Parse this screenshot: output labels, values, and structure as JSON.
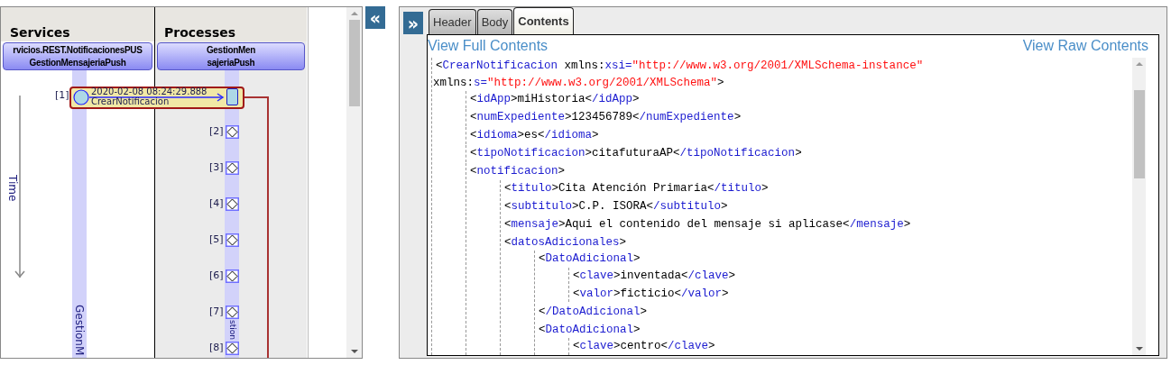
{
  "sequence_diagram": {
    "collapse_button": "«",
    "time_axis": "Time",
    "columns": [
      {
        "title": "Services",
        "participant": [
          "rvicios.REST.NotificacionesPUS",
          "GestionMensajeriaPush"
        ],
        "lifeline_label": "GestionM"
      },
      {
        "title": "Processes",
        "participant": [
          "GestionMen",
          "sajeriaPush"
        ],
        "lifeline_label": "stion"
      }
    ],
    "message": {
      "index": "[1]",
      "timestamp": "2020-02-08 08:24:29.888",
      "name": "CrearNotificacion",
      "selected": true
    },
    "events": [
      {
        "index": "[2]"
      },
      {
        "index": "[3]"
      },
      {
        "index": "[4]"
      },
      {
        "index": "[5]"
      },
      {
        "index": "[6]"
      },
      {
        "index": "[7]"
      },
      {
        "index": "[8]"
      }
    ]
  },
  "detail_panel": {
    "expand_button": "»",
    "tabs": [
      {
        "label": "Header",
        "selected": false
      },
      {
        "label": "Body",
        "selected": false
      },
      {
        "label": "Contents",
        "selected": true
      }
    ],
    "links": [
      "View Full Contents",
      "View Raw Contents"
    ],
    "xml": [
      {
        "lines": [
          [
            {
              "kind": "punct",
              "text": "<"
            },
            {
              "kind": "tag",
              "text": "CrearNotificacion"
            },
            {
              "kind": "attr",
              "text": " xmlns:"
            },
            {
              "kind": "tag",
              "text": "xsi="
            },
            {
              "kind": "value",
              "text": "\"http://www.w3.org/2001/XMLSchema-instance\""
            }
          ],
          [
            {
              "kind": "attr",
              "text": "xmlns:"
            },
            {
              "kind": "tag",
              "text": "s="
            },
            {
              "kind": "value",
              "text": "\"http://www.w3.org/2001/XMLSchema\""
            },
            {
              "kind": "punct",
              "text": ">"
            }
          ]
        ],
        "children": [
          {
            "lines": [
              [
                {
                  "kind": "punct",
                  "text": "<"
                },
                {
                  "kind": "tag",
                  "text": "idApp"
                },
                {
                  "kind": "punct",
                  "text": ">"
                },
                {
                  "kind": "text",
                  "text": "miHistoria"
                },
                {
                  "kind": "punct",
                  "text": "<"
                },
                {
                  "kind": "tag",
                  "text": "/idApp"
                },
                {
                  "kind": "punct",
                  "text": ">"
                }
              ]
            ]
          },
          {
            "lines": [
              [
                {
                  "kind": "punct",
                  "text": "<"
                },
                {
                  "kind": "tag",
                  "text": "numExpediente"
                },
                {
                  "kind": "punct",
                  "text": ">"
                },
                {
                  "kind": "text",
                  "text": "123456789"
                },
                {
                  "kind": "punct",
                  "text": "<"
                },
                {
                  "kind": "tag",
                  "text": "/numExpediente"
                },
                {
                  "kind": "punct",
                  "text": ">"
                }
              ]
            ]
          },
          {
            "lines": [
              [
                {
                  "kind": "punct",
                  "text": "<"
                },
                {
                  "kind": "tag",
                  "text": "idioma"
                },
                {
                  "kind": "punct",
                  "text": ">"
                },
                {
                  "kind": "text",
                  "text": "es"
                },
                {
                  "kind": "punct",
                  "text": "<"
                },
                {
                  "kind": "tag",
                  "text": "/idioma"
                },
                {
                  "kind": "punct",
                  "text": ">"
                }
              ]
            ]
          },
          {
            "lines": [
              [
                {
                  "kind": "punct",
                  "text": "<"
                },
                {
                  "kind": "tag",
                  "text": "tipoNotificacion"
                },
                {
                  "kind": "punct",
                  "text": ">"
                },
                {
                  "kind": "text",
                  "text": "citafuturaAP"
                },
                {
                  "kind": "punct",
                  "text": "<"
                },
                {
                  "kind": "tag",
                  "text": "/tipoNotificacion"
                },
                {
                  "kind": "punct",
                  "text": ">"
                }
              ]
            ]
          },
          {
            "lines": [
              [
                {
                  "kind": "punct",
                  "text": "<"
                },
                {
                  "kind": "tag",
                  "text": "notificacion"
                },
                {
                  "kind": "punct",
                  "text": ">"
                }
              ]
            ],
            "children": [
              {
                "lines": [
                  [
                    {
                      "kind": "punct",
                      "text": "<"
                    },
                    {
                      "kind": "tag",
                      "text": "titulo"
                    },
                    {
                      "kind": "punct",
                      "text": ">"
                    },
                    {
                      "kind": "text",
                      "text": "Cita Atención Primaria"
                    },
                    {
                      "kind": "punct",
                      "text": "<"
                    },
                    {
                      "kind": "tag",
                      "text": "/titulo"
                    },
                    {
                      "kind": "punct",
                      "text": ">"
                    }
                  ]
                ]
              },
              {
                "lines": [
                  [
                    {
                      "kind": "punct",
                      "text": "<"
                    },
                    {
                      "kind": "tag",
                      "text": "subtitulo"
                    },
                    {
                      "kind": "punct",
                      "text": ">"
                    },
                    {
                      "kind": "text",
                      "text": "C.P. ISORA"
                    },
                    {
                      "kind": "punct",
                      "text": "<"
                    },
                    {
                      "kind": "tag",
                      "text": "/subtitulo"
                    },
                    {
                      "kind": "punct",
                      "text": ">"
                    }
                  ]
                ]
              },
              {
                "lines": [
                  [
                    {
                      "kind": "punct",
                      "text": "<"
                    },
                    {
                      "kind": "tag",
                      "text": "mensaje"
                    },
                    {
                      "kind": "punct",
                      "text": ">"
                    },
                    {
                      "kind": "text",
                      "text": "Aqui el contenido del mensaje si aplicase"
                    },
                    {
                      "kind": "punct",
                      "text": "<"
                    },
                    {
                      "kind": "tag",
                      "text": "/mensaje"
                    },
                    {
                      "kind": "punct",
                      "text": ">"
                    }
                  ]
                ]
              },
              {
                "lines": [
                  [
                    {
                      "kind": "punct",
                      "text": "<"
                    },
                    {
                      "kind": "tag",
                      "text": "datosAdicionales"
                    },
                    {
                      "kind": "punct",
                      "text": ">"
                    }
                  ]
                ],
                "children": [
                  {
                    "lines": [
                      [
                        {
                          "kind": "punct",
                          "text": "<"
                        },
                        {
                          "kind": "tag",
                          "text": "DatoAdicional"
                        },
                        {
                          "kind": "punct",
                          "text": ">"
                        }
                      ]
                    ],
                    "children": [
                      {
                        "lines": [
                          [
                            {
                              "kind": "punct",
                              "text": "<"
                            },
                            {
                              "kind": "tag",
                              "text": "clave"
                            },
                            {
                              "kind": "punct",
                              "text": ">"
                            },
                            {
                              "kind": "text",
                              "text": "inventada"
                            },
                            {
                              "kind": "punct",
                              "text": "<"
                            },
                            {
                              "kind": "tag",
                              "text": "/clave"
                            },
                            {
                              "kind": "punct",
                              "text": ">"
                            }
                          ]
                        ]
                      },
                      {
                        "lines": [
                          [
                            {
                              "kind": "punct",
                              "text": "<"
                            },
                            {
                              "kind": "tag",
                              "text": "valor"
                            },
                            {
                              "kind": "punct",
                              "text": ">"
                            },
                            {
                              "kind": "text",
                              "text": "ficticio"
                            },
                            {
                              "kind": "punct",
                              "text": "<"
                            },
                            {
                              "kind": "tag",
                              "text": "/valor"
                            },
                            {
                              "kind": "punct",
                              "text": ">"
                            }
                          ]
                        ]
                      }
                    ]
                  },
                  {
                    "lines": [
                      [
                        {
                          "kind": "punct",
                          "text": "<"
                        },
                        {
                          "kind": "tag",
                          "text": "/DatoAdicional"
                        },
                        {
                          "kind": "punct",
                          "text": ">"
                        }
                      ]
                    ]
                  },
                  {
                    "lines": [
                      [
                        {
                          "kind": "punct",
                          "text": "<"
                        },
                        {
                          "kind": "tag",
                          "text": "DatoAdicional"
                        },
                        {
                          "kind": "punct",
                          "text": ">"
                        }
                      ]
                    ],
                    "children": [
                      {
                        "lines": [
                          [
                            {
                              "kind": "punct",
                              "text": "<"
                            },
                            {
                              "kind": "tag",
                              "text": "clave"
                            },
                            {
                              "kind": "punct",
                              "text": ">"
                            },
                            {
                              "kind": "text",
                              "text": "centro"
                            },
                            {
                              "kind": "punct",
                              "text": "<"
                            },
                            {
                              "kind": "tag",
                              "text": "/clave"
                            },
                            {
                              "kind": "punct",
                              "text": ">"
                            }
                          ]
                        ]
                      }
                    ]
                  }
                ]
              }
            ]
          }
        ]
      }
    ]
  }
}
